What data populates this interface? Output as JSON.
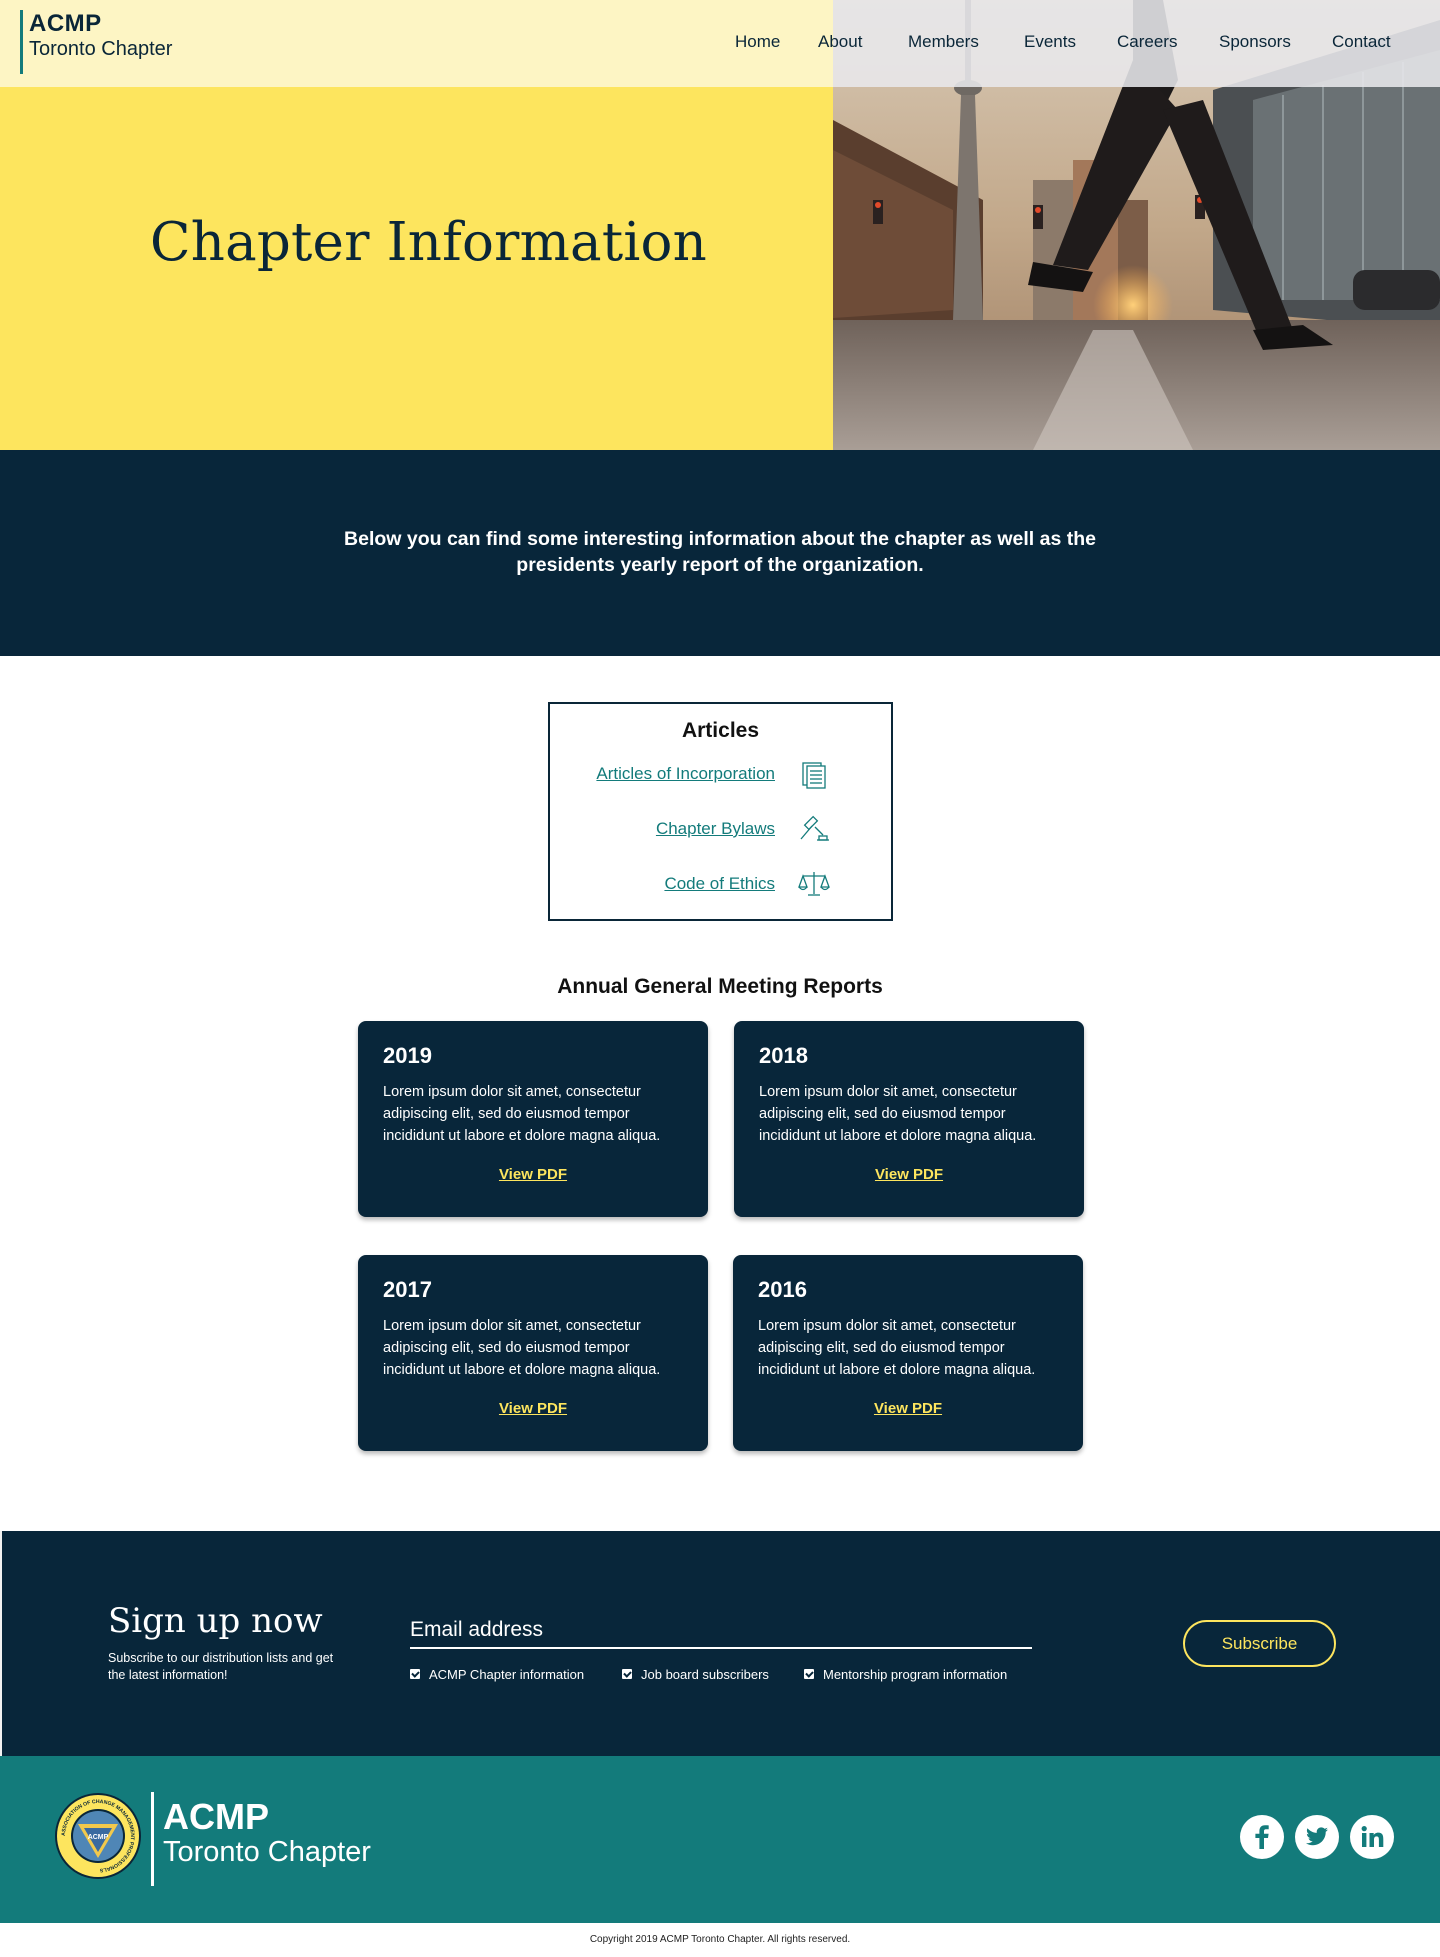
{
  "brand": {
    "acmp": "ACMP",
    "subtitle": "Toronto Chapter"
  },
  "nav": {
    "items": [
      {
        "label": "Home"
      },
      {
        "label": "About"
      },
      {
        "label": "Members"
      },
      {
        "label": "Events"
      },
      {
        "label": "Careers"
      },
      {
        "label": "Sponsors"
      },
      {
        "label": "Contact"
      }
    ]
  },
  "hero": {
    "title": "Chapter Information",
    "image": "toronto-street-walker-photo"
  },
  "intro": {
    "text": "Below you can find some interesting information about the chapter as well as the presidents yearly report of the organization."
  },
  "articles": {
    "title": "Articles",
    "items": [
      {
        "label": "Articles of Incorporation",
        "icon": "document-stack-icon"
      },
      {
        "label": "Chapter Bylaws",
        "icon": "gavel-icon"
      },
      {
        "label": "Code of Ethics",
        "icon": "scales-icon"
      }
    ]
  },
  "reports": {
    "title": "Annual General Meeting Reports",
    "cards": [
      {
        "year": "2019",
        "text": "Lorem ipsum dolor sit amet, consectetur adipiscing elit, sed do eiusmod tempor incididunt ut labore et dolore magna aliqua.",
        "link": "View PDF"
      },
      {
        "year": "2018",
        "text": "Lorem ipsum dolor sit amet, consectetur adipiscing elit, sed do eiusmod tempor incididunt ut labore et dolore magna aliqua.",
        "link": "View PDF"
      },
      {
        "year": "2017",
        "text": "Lorem ipsum dolor sit amet, consectetur adipiscing elit, sed do eiusmod tempor incididunt ut labore et dolore magna aliqua.",
        "link": "View PDF"
      },
      {
        "year": "2016",
        "text": "Lorem ipsum dolor sit amet, consectetur adipiscing elit, sed do eiusmod tempor incididunt ut labore et dolore magna aliqua.",
        "link": "View PDF"
      }
    ]
  },
  "signup": {
    "title": "Sign up now",
    "subtitle": "Subscribe to our distribution lists and get the latest information!",
    "email_placeholder": "Email address",
    "options": [
      {
        "label": "ACMP Chapter information",
        "checked": true
      },
      {
        "label": "Job board subscribers",
        "checked": true
      },
      {
        "label": "Mentorship program information",
        "checked": true
      }
    ],
    "button": "Subscribe"
  },
  "footer": {
    "acmp": "ACMP",
    "subtitle": "Toronto Chapter",
    "logo_seal_text": "ASSOCIATION OF CHANGE MANAGEMENT PROFESSIONALS",
    "logo_center_text": "ACMP",
    "social": [
      "facebook-icon",
      "twitter-icon",
      "linkedin-icon"
    ],
    "copyright": "Copyright 2019 ACMP Toronto Chapter. All rights reserved."
  },
  "colors": {
    "navy": "#08263a",
    "teal": "#137b7b",
    "yellow": "#fde55e",
    "pale_yellow": "#fdf5c4"
  }
}
